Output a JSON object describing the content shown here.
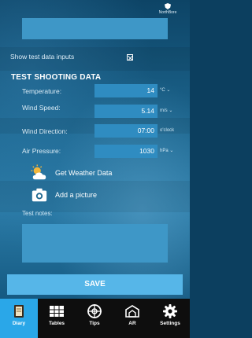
{
  "brand": {
    "name": "NorthBore"
  },
  "test_inputs": {
    "show_label": "Show test data inputs",
    "section_title": "TEST SHOOTING DATA",
    "rows": [
      {
        "label": "Temperature:",
        "value": "14",
        "unit": "°C"
      },
      {
        "label": "Wind Speed:",
        "value": "5.14",
        "unit": "m/s"
      },
      {
        "label": "Wind Direction:",
        "value": "07:00",
        "unit": "o'clock"
      },
      {
        "label": "Air Pressure:",
        "value": "1030",
        "unit": "hPa"
      }
    ]
  },
  "actions": {
    "weather": "Get Weather Data",
    "picture": "Add a picture"
  },
  "notes": {
    "label": "Test notes:"
  },
  "save": {
    "label": "SAVE"
  },
  "tabs": [
    {
      "label": "Diary",
      "icon": "diary-icon",
      "active": true
    },
    {
      "label": "Tables",
      "icon": "tables-icon"
    },
    {
      "label": "Tips",
      "icon": "tips-icon"
    },
    {
      "label": "AR",
      "icon": "ar-icon"
    },
    {
      "label": "Settings",
      "icon": "settings-icon"
    }
  ],
  "colors": {
    "accent": "#2aa7e8",
    "field": "#2f8cc1",
    "save": "#56b6e8"
  }
}
